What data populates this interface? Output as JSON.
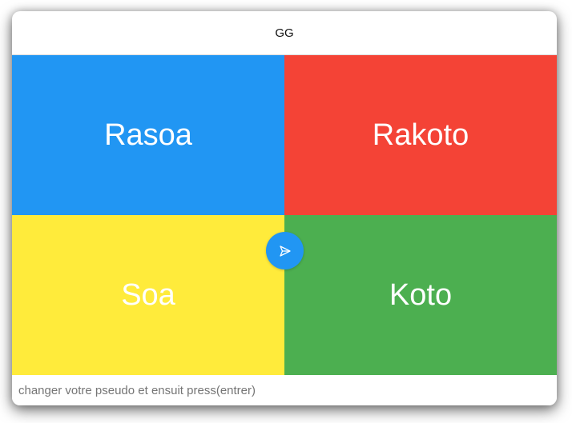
{
  "header": {
    "title": "GG"
  },
  "tiles": [
    {
      "label": "Rasoa",
      "color": "#2196F3"
    },
    {
      "label": "Rakoto",
      "color": "#F44336"
    },
    {
      "label": "Soa",
      "color": "#FFEB3B"
    },
    {
      "label": "Koto",
      "color": "#4CAF50"
    }
  ],
  "fab": {
    "icon": "send-icon",
    "color": "#2196F3"
  },
  "pseudo_input": {
    "placeholder": "changer votre pseudo et ensuit press(entrer)",
    "value": ""
  }
}
